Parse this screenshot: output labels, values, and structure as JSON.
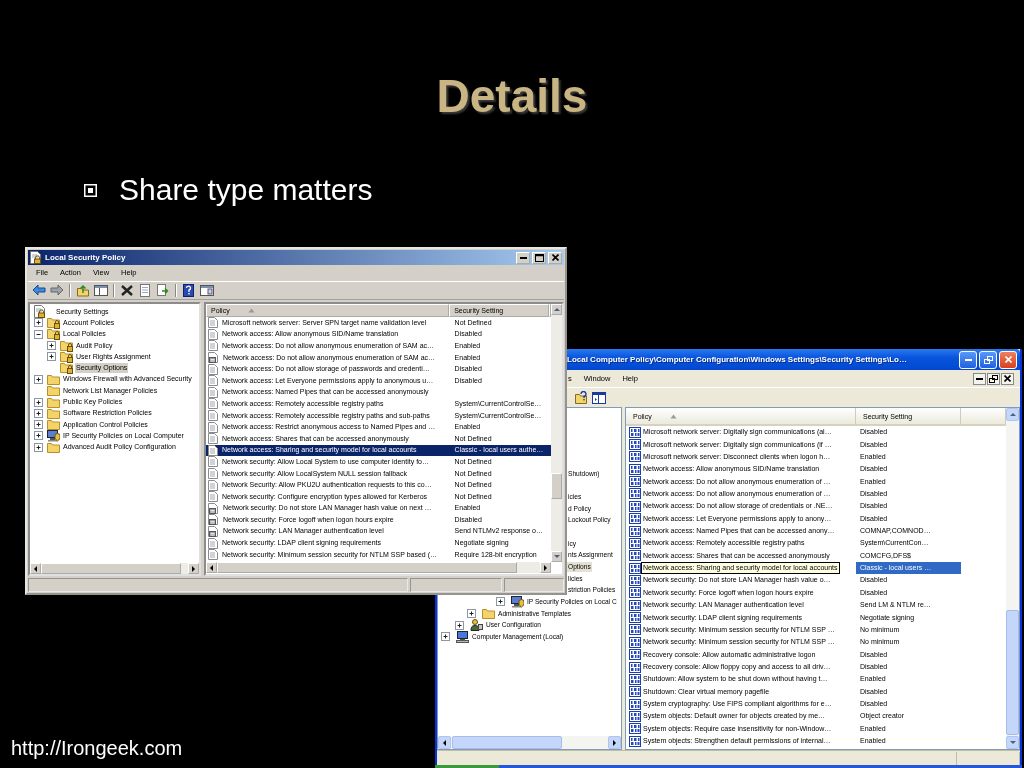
{
  "slide": {
    "title": "Details",
    "bullets": [
      "Share type matters"
    ],
    "footer": "http://Irongeek.com"
  },
  "back_window": {
    "title": "Local Computer Policy\\Computer Configuration\\Windows Settings\\Security Settings\\Lo…",
    "menu": [
      "s",
      "Window",
      "Help"
    ],
    "tree_rows": [
      {
        "label": "Shutdown)",
        "kind": "text",
        "selected": false
      },
      {
        "label": "icies",
        "kind": "text",
        "selected": false
      },
      {
        "label": "d Policy",
        "kind": "text",
        "selected": false
      },
      {
        "label": "Lockout Policy",
        "kind": "text",
        "selected": false
      },
      {
        "label": "icy",
        "kind": "text",
        "selected": false
      },
      {
        "label": "nts Assignment",
        "kind": "text",
        "selected": false
      },
      {
        "label": "Options",
        "kind": "text",
        "selected": true
      },
      {
        "label": "licies",
        "kind": "text",
        "selected": false
      },
      {
        "label": "striction Policies",
        "kind": "text",
        "selected": false
      },
      {
        "label": "IP Security Policies on Local C",
        "kind": "shield-computer",
        "expanded": false,
        "selected": false
      },
      {
        "label": "Administrative Templates",
        "kind": "folder",
        "expanded": false,
        "selected": false
      },
      {
        "label": "User Configuration",
        "kind": "user",
        "expanded": false,
        "selected": false
      },
      {
        "label": "Computer Management (Local)",
        "kind": "computer",
        "expanded": false,
        "selected": false
      }
    ],
    "columns": [
      {
        "label": "Policy",
        "sorted": true
      },
      {
        "label": "Security Setting",
        "sorted": false
      }
    ],
    "rows": [
      {
        "policy": "Microsoft network server: Digitally sign communications (al…",
        "setting": "Disabled",
        "selected": false
      },
      {
        "policy": "Microsoft network server: Digitally sign communications (if …",
        "setting": "Disabled",
        "selected": false
      },
      {
        "policy": "Microsoft network server: Disconnect clients when logon h…",
        "setting": "Enabled",
        "selected": false
      },
      {
        "policy": "Network access: Allow anonymous SID/Name translation",
        "setting": "Disabled",
        "selected": false
      },
      {
        "policy": "Network access: Do not allow anonymous enumeration of …",
        "setting": "Enabled",
        "selected": false
      },
      {
        "policy": "Network access: Do not allow anonymous enumeration of …",
        "setting": "Disabled",
        "selected": false
      },
      {
        "policy": "Network access: Do not allow storage of credentials or .NE…",
        "setting": "Disabled",
        "selected": false
      },
      {
        "policy": "Network access: Let Everyone permissions apply to anony…",
        "setting": "Disabled",
        "selected": false
      },
      {
        "policy": "Network access: Named Pipes that can be accessed anony…",
        "setting": "COMNAP,COMNOD…",
        "selected": false
      },
      {
        "policy": "Network access: Remotely accessible registry paths",
        "setting": "System\\CurrentCon…",
        "selected": false
      },
      {
        "policy": "Network access: Shares that can be accessed anonymously",
        "setting": "COMCFG,DFS$",
        "selected": false
      },
      {
        "policy": "Network access: Sharing and security model for local accounts",
        "setting": "Classic - local users …",
        "selected": true
      },
      {
        "policy": "Network security: Do not store LAN Manager hash value o…",
        "setting": "Disabled",
        "selected": false
      },
      {
        "policy": "Network security: Force logoff when logon hours expire",
        "setting": "Disabled",
        "selected": false
      },
      {
        "policy": "Network security: LAN Manager authentication level",
        "setting": "Send LM & NTLM re…",
        "selected": false
      },
      {
        "policy": "Network security: LDAP client signing requirements",
        "setting": "Negotiate signing",
        "selected": false
      },
      {
        "policy": "Network security: Minimum session security for NTLM SSP …",
        "setting": "No minimum",
        "selected": false
      },
      {
        "policy": "Network security: Minimum session security for NTLM SSP …",
        "setting": "No minimum",
        "selected": false
      },
      {
        "policy": "Recovery console: Allow automatic administrative logon",
        "setting": "Disabled",
        "selected": false
      },
      {
        "policy": "Recovery console: Allow floppy copy and access to all driv…",
        "setting": "Disabled",
        "selected": false
      },
      {
        "policy": "Shutdown: Allow system to be shut down without having t…",
        "setting": "Enabled",
        "selected": false
      },
      {
        "policy": "Shutdown: Clear virtual memory pagefile",
        "setting": "Disabled",
        "selected": false
      },
      {
        "policy": "System cryptography: Use FIPS compliant algorithms for e…",
        "setting": "Disabled",
        "selected": false
      },
      {
        "policy": "System objects: Default owner for objects created by me…",
        "setting": "Object creator",
        "selected": false
      },
      {
        "policy": "System objects: Require case insensitivity for non-Window…",
        "setting": "Enabled",
        "selected": false
      },
      {
        "policy": "System objects: Strengthen default permissions of internal…",
        "setting": "Enabled",
        "selected": false
      }
    ]
  },
  "front_window": {
    "title": "Local Security Policy",
    "menu": [
      "File",
      "Action",
      "View",
      "Help"
    ],
    "tree": [
      {
        "label": "Security Settings",
        "kind": "root",
        "selected": false,
        "children": [
          {
            "label": "Account Policies",
            "kind": "lock-folder",
            "expanded": false,
            "selected": false
          },
          {
            "label": "Local Policies",
            "kind": "lock-folder",
            "expanded": true,
            "selected": false,
            "children": [
              {
                "label": "Audit Policy",
                "kind": "lock-folder",
                "expanded": false,
                "selected": false
              },
              {
                "label": "User Rights Assignment",
                "kind": "lock-folder",
                "expanded": false,
                "selected": false
              },
              {
                "label": "Security Options",
                "kind": "lock-folder",
                "selected": true
              }
            ]
          },
          {
            "label": "Windows Firewall with Advanced Security",
            "kind": "folder",
            "expanded": false,
            "selected": false
          },
          {
            "label": "Network List Manager Policies",
            "kind": "folder",
            "selected": false
          },
          {
            "label": "Public Key Policies",
            "kind": "folder",
            "expanded": false,
            "selected": false
          },
          {
            "label": "Software Restriction Policies",
            "kind": "folder",
            "expanded": false,
            "selected": false
          },
          {
            "label": "Application Control Policies",
            "kind": "folder",
            "expanded": false,
            "selected": false
          },
          {
            "label": "IP Security Policies on Local Computer",
            "kind": "shield-computer",
            "expanded": false,
            "selected": false
          },
          {
            "label": "Advanced Audit Policy Configuration",
            "kind": "folder",
            "expanded": false,
            "selected": false
          }
        ]
      }
    ],
    "columns": [
      {
        "label": "Policy",
        "sorted": true
      },
      {
        "label": "Security Setting",
        "sorted": false
      }
    ],
    "rows": [
      {
        "policy": "Microsoft network server: Server SPN target name validation level",
        "setting": "Not Defined",
        "kind": "doc",
        "selected": false
      },
      {
        "policy": "Network access: Allow anonymous SID/Name translation",
        "setting": "Disabled",
        "kind": "doc",
        "selected": false
      },
      {
        "policy": "Network access: Do not allow anonymous enumeration of SAM ac…",
        "setting": "Enabled",
        "kind": "doc",
        "selected": false
      },
      {
        "policy": "Network access: Do not allow anonymous enumeration of SAM ac…",
        "setting": "Enabled",
        "kind": "stack",
        "selected": false
      },
      {
        "policy": "Network access: Do not allow storage of passwords and credenti…",
        "setting": "Disabled",
        "kind": "doc",
        "selected": false
      },
      {
        "policy": "Network access: Let Everyone permissions apply to anonymous u…",
        "setting": "Disabled",
        "kind": "doc",
        "selected": false
      },
      {
        "policy": "Network access: Named Pipes that can be accessed anonymously",
        "kind": "doc",
        "selected": false
      },
      {
        "policy": "Network access: Remotely accessible registry paths",
        "setting": "System\\CurrentControlSe…",
        "kind": "doc",
        "selected": false
      },
      {
        "policy": "Network access: Remotely accessible registry paths and sub-paths",
        "setting": "System\\CurrentControlSe…",
        "kind": "doc",
        "selected": false
      },
      {
        "policy": "Network access: Restrict anonymous access to Named Pipes and …",
        "setting": "Enabled",
        "kind": "doc",
        "selected": false
      },
      {
        "policy": "Network access: Shares that can be accessed anonymously",
        "setting": "Not Defined",
        "kind": "doc",
        "selected": false
      },
      {
        "policy": "Network access: Sharing and security model for local accounts",
        "setting": "Classic - local users authe…",
        "kind": "doc",
        "selected": true
      },
      {
        "policy": "Network security: Allow Local System to use computer identity fo…",
        "setting": "Not Defined",
        "kind": "doc",
        "selected": false
      },
      {
        "policy": "Network security: Allow LocalSystem NULL session fallback",
        "setting": "Not Defined",
        "kind": "doc",
        "selected": false
      },
      {
        "policy": "Network Security: Allow PKU2U authentication requests to this co…",
        "setting": "Not Defined",
        "kind": "doc",
        "selected": false
      },
      {
        "policy": "Network security: Configure encryption types allowed for Kerberos",
        "setting": "Not Defined",
        "kind": "doc",
        "selected": false
      },
      {
        "policy": "Network security: Do not store LAN Manager hash value on next …",
        "setting": "Enabled",
        "kind": "stack",
        "selected": false
      },
      {
        "policy": "Network security: Force logoff when logon hours expire",
        "setting": "Disabled",
        "kind": "stack",
        "selected": false
      },
      {
        "policy": "Network security: LAN Manager authentication level",
        "setting": "Send NTLMv2 response o…",
        "kind": "stack",
        "selected": false
      },
      {
        "policy": "Network security: LDAP client signing requirements",
        "setting": "Negotiate signing",
        "kind": "doc",
        "selected": false
      },
      {
        "policy": "Network security: Minimum session security for NTLM SSP based (…",
        "setting": "Require 128-bit encryption",
        "kind": "doc",
        "selected": false
      }
    ]
  }
}
